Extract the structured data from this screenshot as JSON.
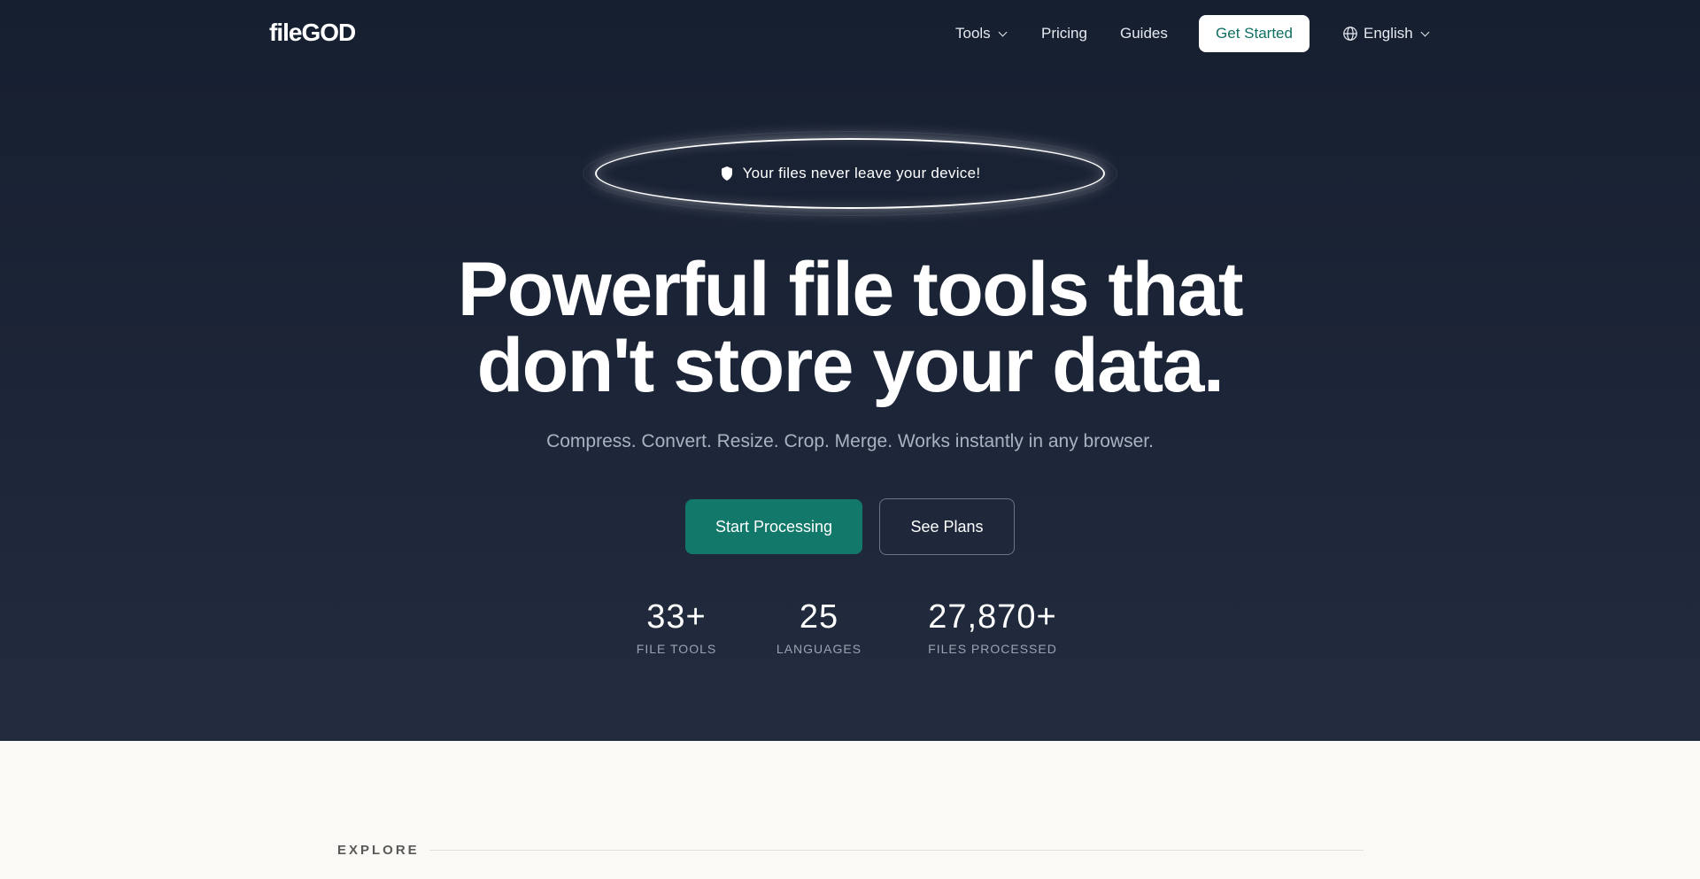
{
  "nav": {
    "logo": "fileGOD",
    "tools_label": "Tools",
    "pricing_label": "Pricing",
    "guides_label": "Guides",
    "get_started_label": "Get Started",
    "language_label": "English"
  },
  "hero": {
    "badge_text": "Your files never leave your device!",
    "headline_line1": "Powerful file tools that",
    "headline_line2": "don't store your data.",
    "subtitle": "Compress. Convert. Resize. Crop. Merge. Works instantly in any browser.",
    "primary_cta": "Start Processing",
    "secondary_cta": "See Plans"
  },
  "stats": [
    {
      "value": "33+",
      "label": "FILE TOOLS"
    },
    {
      "value": "25",
      "label": "LANGUAGES"
    },
    {
      "value": "27,870+",
      "label": "FILES PROCESSED"
    }
  ],
  "explore": {
    "label": "EXPLORE"
  },
  "icons": {
    "tools_chevron": "chevron-down-icon",
    "language_globe": "globe-icon",
    "language_chevron": "chevron-down-icon",
    "badge_shield": "shield-icon"
  },
  "colors": {
    "hero_bg_top": "#161f30",
    "hero_bg_bottom": "#232c3f",
    "accent": "#11786a",
    "page_bg": "#faf9f5"
  }
}
